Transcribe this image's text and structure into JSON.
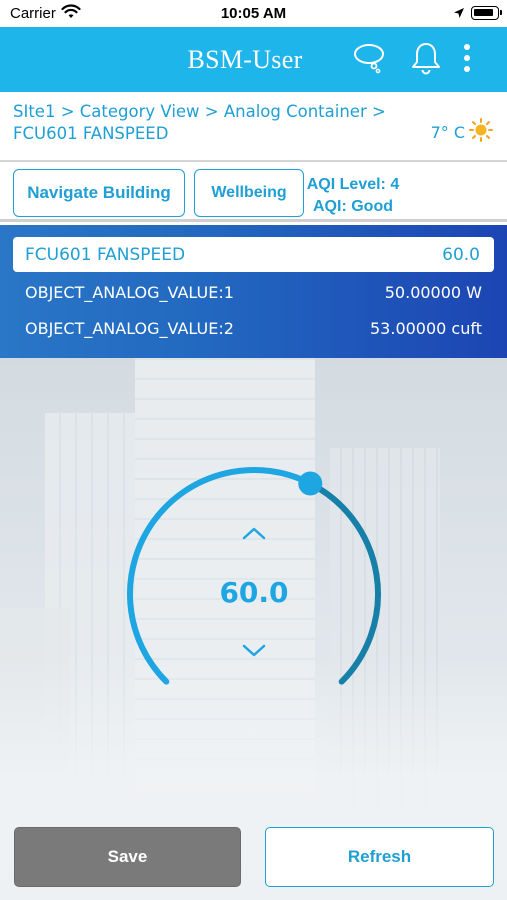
{
  "status_bar": {
    "carrier": "Carrier",
    "time": "10:05 AM"
  },
  "header": {
    "title": "BSM-User",
    "icons": [
      "chat-icon",
      "bell-icon",
      "more-vertical-icon"
    ],
    "background": "#1eb5ea"
  },
  "breadcrumb": {
    "line1": "SIte1 > Category View > Analog Container >",
    "line2": "FCU601 FANSPEED"
  },
  "weather": {
    "temperature": "7° C",
    "icon": "sun-icon"
  },
  "actions": {
    "navigate_label": "Navigate Building",
    "wellbeing_label": "Wellbeing",
    "aqi_level": "AQI Level: 4",
    "aqi_status": "AQI: Good"
  },
  "info": {
    "selected": {
      "name": "FCU601 FANSPEED",
      "value": "60.0"
    },
    "objects": [
      {
        "name": "OBJECT_ANALOG_VALUE:1",
        "value": "50.00000 W"
      },
      {
        "name": "OBJECT_ANALOG_VALUE:2",
        "value": "53.00000 cuft"
      }
    ]
  },
  "dial": {
    "value": "60.0",
    "fraction": 0.6,
    "accent": "#1ea6e2",
    "track": "#1780a8"
  },
  "footer": {
    "save_label": "Save",
    "refresh_label": "Refresh"
  }
}
